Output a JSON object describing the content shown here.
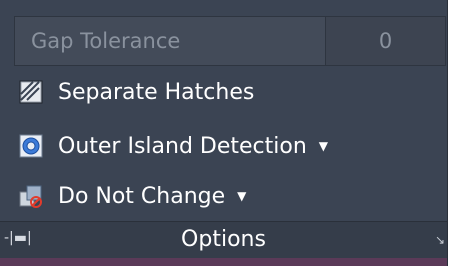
{
  "gap_tolerance": {
    "label": "Gap Tolerance",
    "value": "0"
  },
  "tools": [
    {
      "label": "Separate Hatches",
      "icon": "separate-hatches-icon"
    },
    {
      "label": "Outer Island Detection",
      "icon": "outer-island-detection-icon",
      "has_dropdown": true
    },
    {
      "label": "Do Not Change",
      "icon": "do-not-change-icon",
      "has_dropdown": true
    }
  ],
  "footer": {
    "title": "Options"
  },
  "colors": {
    "panel": "#3b4453",
    "text": "#ffffff",
    "muted_text": "#8a929e",
    "accent": "#5b3a58"
  }
}
